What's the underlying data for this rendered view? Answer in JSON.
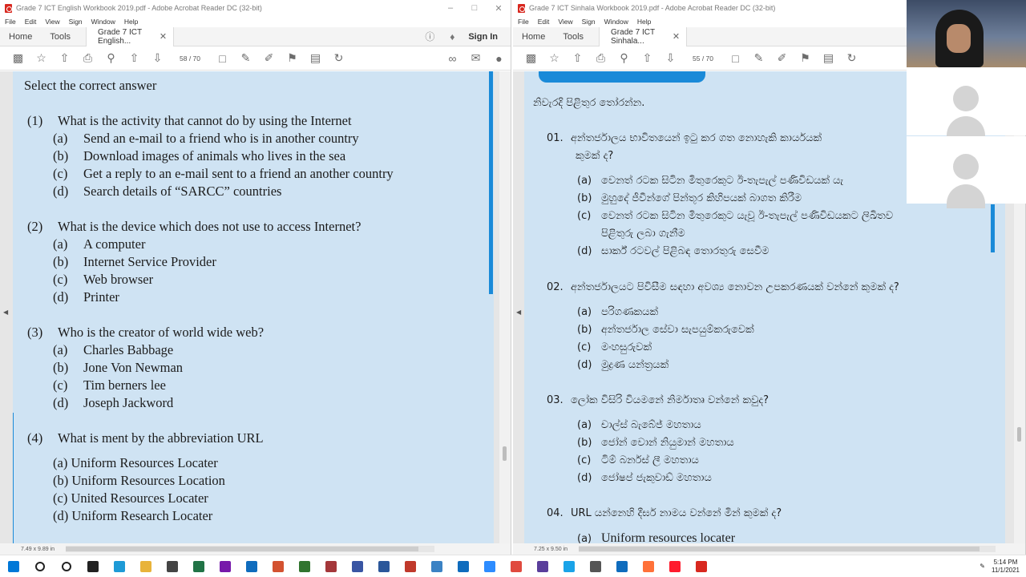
{
  "left_window": {
    "title": "Grade 7 ICT English Workbook 2019.pdf - Adobe Acrobat Reader DC (32-bit)",
    "menu": [
      "File",
      "Edit",
      "View",
      "Sign",
      "Window",
      "Help"
    ],
    "nav_home": "Home",
    "nav_tools": "Tools",
    "tab_label": "Grade 7 ICT English...",
    "signin": "Sign In",
    "page_current": "58",
    "page_total": "/ 70",
    "page_size": "7.49 x 9.89 in",
    "content": {
      "heading": "Select the correct answer",
      "questions": [
        {
          "num": "(1)",
          "text": "What is the activity that cannot do by using the Internet",
          "options": [
            [
              "(a)",
              "Send an e-mail to a friend who is in another country"
            ],
            [
              "(b)",
              "Download images of animals who lives in the sea"
            ],
            [
              "(c)",
              "Get a reply to an e-mail sent to a friend an another country"
            ],
            [
              "(d)",
              "Search details of “SARCC” countries"
            ]
          ]
        },
        {
          "num": "(2)",
          "text": "What is the device which does not use to access Internet?",
          "options": [
            [
              "(a)",
              "A computer"
            ],
            [
              "(b)",
              "Internet Service Provider"
            ],
            [
              "(c)",
              "Web browser"
            ],
            [
              "(d)",
              "Printer"
            ]
          ]
        },
        {
          "num": "(3)",
          "text": "Who is the creator of world wide web?",
          "options": [
            [
              "(a)",
              "Charles Babbage"
            ],
            [
              "(b)",
              "Jone Von Newman"
            ],
            [
              "(c)",
              "Tim berners lee"
            ],
            [
              "(d)",
              "Joseph Jackword"
            ]
          ]
        },
        {
          "num": "(4)",
          "text": "What is ment by the abbreviation URL",
          "options": [
            [
              "(a)",
              "Uniform Resources Locater"
            ],
            [
              "(b)",
              "Uniform Resources Location"
            ],
            [
              "(c)",
              "United  Resources Locater"
            ],
            [
              "(d)",
              "Uniform Research Locater"
            ]
          ]
        }
      ]
    }
  },
  "right_window": {
    "title": "Grade 7 ICT Sinhala Workbook 2019.pdf - Adobe Acrobat Reader DC (32-bit)",
    "menu": [
      "File",
      "Edit",
      "View",
      "Sign",
      "Window",
      "Help"
    ],
    "nav_home": "Home",
    "nav_tools": "Tools",
    "tab_label": "Grade 7 ICT Sinhala...",
    "page_current": "55",
    "page_total": "/ 70",
    "page_size": "7.25 x 9.50 in",
    "content": {
      "heading": "නිවැරදි පිළිතුර තෝරන්න.",
      "questions": [
        {
          "num": "01.",
          "text": "අන්තර්ජාලය භාවිතයෙන් ඉටු කර ගත නොහැකි කාර්යයක්",
          "text2": "කුමක් ද?",
          "options": [
            [
              "(a)",
              "වෙනත් රටක සිටින මිතුරෙකුට ඊ-තැපැල් පණිවිඩයක් යැ"
            ],
            [
              "(b)",
              "මුහුදේ ජීවීන්ගේ පින්තූර කිහිපයක් බාගත කිරීම"
            ],
            [
              "(c)",
              "වෙනත් රටක සිටින මිතුරෙකුට යැවූ ඊ-තැපැල් පණිවිඩයකට ලිඛිතව"
            ],
            [
              "",
              "පිළිතුරු ලබා ගැනීම"
            ],
            [
              "(d)",
              "සාර්ක් රටවල් පිළිබඳ තොරතුරු සෙවීම"
            ]
          ]
        },
        {
          "num": "02.",
          "text": "අන්තර්ජාලයට පිවිසීම සඳහා අවශ්‍ය නොවන උපකරණයක් වන්නේ කුමක් ද?",
          "options": [
            [
              "(a)",
              "පරිගණකයක්"
            ],
            [
              "(b)",
              "අන්තර්ජාල සේවා සැපයුම්කරුවෙක්"
            ],
            [
              "(c)",
              "මංහසුරුවක්"
            ],
            [
              "(d)",
              "මුද්‍රණ යන්ත්‍රයක්"
            ]
          ]
        },
        {
          "num": "03.",
          "text": "ලෝක විසිරි වියමනේ නිර්මාතෘ වන්නේ කවුද?",
          "options": [
            [
              "(a)",
              "චාල්ස් බැබේජ් මහතාය"
            ],
            [
              "(b)",
              "ජෝන් වොන් නියුමාන් මහතාය"
            ],
            [
              "(c)",
              "ටිම් බර්නස් ලී මහතාය"
            ],
            [
              "(d)",
              "ජෝෂප් ජැකුවාඩ් මහතාය"
            ]
          ]
        },
        {
          "num": "04.",
          "text": "URL යන්නෙහි දීර්ඝ නාමය වන්නේ මින් කුමක් ද?",
          "options": [
            [
              "(a)",
              "Uniform resources locater"
            ]
          ]
        }
      ]
    }
  },
  "taskbar": {
    "time": "5:14 PM",
    "date": "11/1/2021",
    "icons": [
      "windows-start-icon",
      "search-icon",
      "cortana-icon",
      "task-view-icon",
      "edge-icon",
      "file-explorer-icon",
      "store-icon",
      "excel-icon",
      "onenote-icon",
      "outlook-icon",
      "powerpoint-icon",
      "project-icon",
      "access-icon",
      "visio-icon",
      "word-icon",
      "app-icon",
      "browser-icon",
      "mail-icon",
      "zoom-icon",
      "chrome-icon",
      "app2-icon",
      "app3-icon",
      "app4-icon",
      "mail2-icon",
      "firefox-icon",
      "opera-icon",
      "acrobat-icon"
    ],
    "colors": [
      "#0078d7",
      "#222222",
      "#222222",
      "#222222",
      "#1e9ad6",
      "#e8b33a",
      "#444444",
      "#217346",
      "#7719aa",
      "#0f6cbd",
      "#d35230",
      "#31752f",
      "#a4373a",
      "#3955a3",
      "#2b579a",
      "#c0392b",
      "#3b82c4",
      "#0f6cbd",
      "#2d8cff",
      "#e04a3f",
      "#5a3e9b",
      "#1aa3e8",
      "#555555",
      "#0f6cbd",
      "#ff7139",
      "#ff1b2d",
      "#d8281f"
    ]
  }
}
